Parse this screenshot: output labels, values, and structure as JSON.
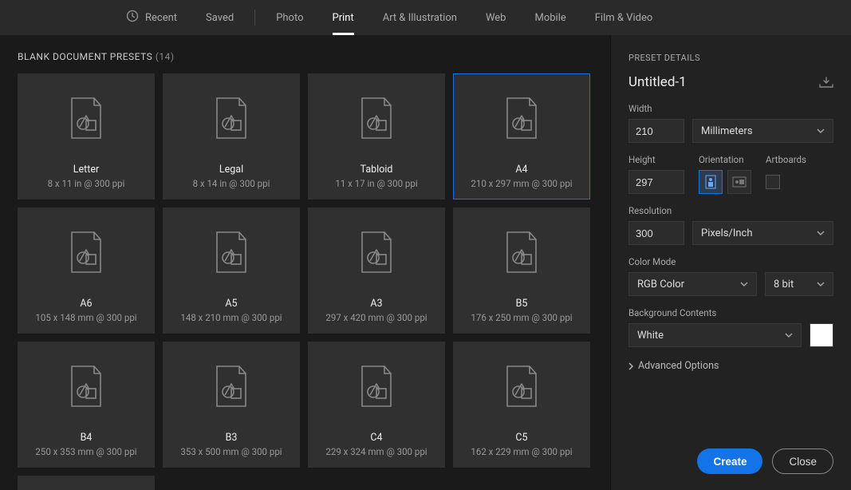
{
  "tabs": {
    "recent": "Recent",
    "saved": "Saved",
    "photo": "Photo",
    "print": "Print",
    "art": "Art & Illustration",
    "web": "Web",
    "mobile": "Mobile",
    "film": "Film & Video"
  },
  "section": {
    "title": "BLANK DOCUMENT PRESETS",
    "count": "(14)"
  },
  "presets": [
    {
      "name": "Letter",
      "dims": "8 x 11 in @ 300 ppi"
    },
    {
      "name": "Legal",
      "dims": "8 x 14 in @ 300 ppi"
    },
    {
      "name": "Tabloid",
      "dims": "11 x 17 in @ 300 ppi"
    },
    {
      "name": "A4",
      "dims": "210 x 297 mm @ 300 ppi"
    },
    {
      "name": "A6",
      "dims": "105 x 148 mm @ 300 ppi"
    },
    {
      "name": "A5",
      "dims": "148 x 210 mm @ 300 ppi"
    },
    {
      "name": "A3",
      "dims": "297 x 420 mm @ 300 ppi"
    },
    {
      "name": "B5",
      "dims": "176 x 250 mm @ 300 ppi"
    },
    {
      "name": "B4",
      "dims": "250 x 353 mm @ 300 ppi"
    },
    {
      "name": "B3",
      "dims": "353 x 500 mm @ 300 ppi"
    },
    {
      "name": "C4",
      "dims": "229 x 324 mm @ 300 ppi"
    },
    {
      "name": "C5",
      "dims": "162 x 229 mm @ 300 ppi"
    }
  ],
  "details": {
    "panel_title": "PRESET DETAILS",
    "doc_name": "Untitled-1",
    "width_label": "Width",
    "width_value": "210",
    "units": "Millimeters",
    "height_label": "Height",
    "height_value": "297",
    "orientation_label": "Orientation",
    "artboards_label": "Artboards",
    "resolution_label": "Resolution",
    "resolution_value": "300",
    "resolution_units": "Pixels/Inch",
    "color_mode_label": "Color Mode",
    "color_mode_value": "RGB Color",
    "bit_depth": "8 bit",
    "bg_label": "Background Contents",
    "bg_value": "White",
    "bg_color": "#ffffff",
    "advanced": "Advanced Options"
  },
  "buttons": {
    "create": "Create",
    "close": "Close"
  }
}
